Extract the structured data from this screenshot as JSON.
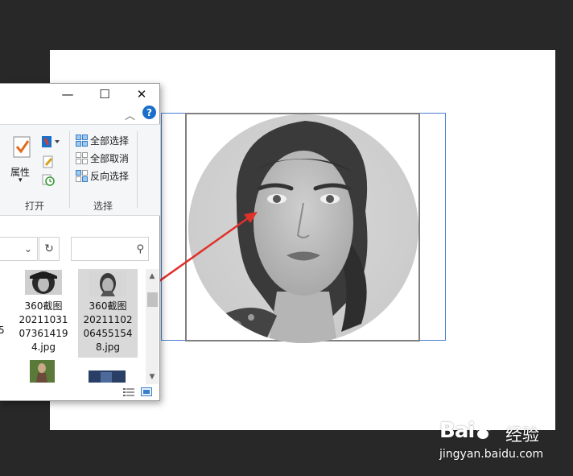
{
  "window_controls": {
    "minimize": "—",
    "maximize": "☐",
    "close": "✕"
  },
  "ribbon": {
    "collapse_chevron": "︿",
    "help": "?",
    "properties_label": "属性",
    "properties_dropdown": "▾",
    "open_group_label": "打开",
    "select_group_label": "选择",
    "select_items": [
      "全部选择",
      "全部取消",
      "反向选择"
    ]
  },
  "address_bar": {
    "dropdown": "⌄",
    "refresh": "↻",
    "search_icon": "⚲",
    "search_placeholder": ""
  },
  "files": [
    {
      "lines": [
        "360截图",
        "20211031",
        "07361419",
        "4.jpg"
      ],
      "selected": false
    },
    {
      "lines": [
        "360截图",
        "20211102",
        "06455154",
        "8.jpg"
      ],
      "selected": true
    }
  ],
  "left_edge_fragment": "5",
  "scroll": {
    "up": "▲",
    "down": "▼"
  },
  "watermark": {
    "logo": "Bai",
    "logo_paw": "du",
    "cn": "经验",
    "url": "jingyan.baidu.com"
  },
  "colors": {
    "selection_border": "#4a7fd4",
    "arrow": "#e0302a",
    "help": "#1a6fc9",
    "canvas_bg": "#282828"
  }
}
